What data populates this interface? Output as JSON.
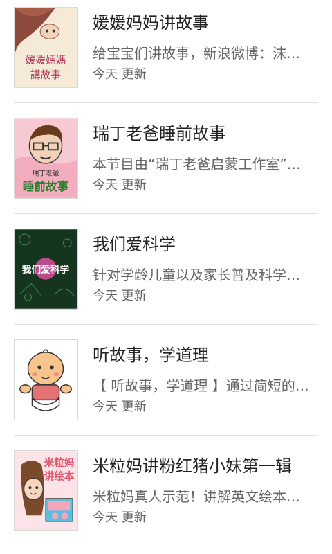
{
  "items": [
    {
      "title": "媛媛妈妈讲故事",
      "description": "给宝宝们讲故事，新浪微博：沫萌宝宝",
      "updated": "今天 更新",
      "thumb_icon": "handdrawn-girl-thumbnail",
      "thumb_text": "媛媛媽媽講故事",
      "bg": "#f5ead7"
    },
    {
      "title": "瑞丁老爸睡前故事",
      "description": "本节目由“瑞丁老爸启蒙工作室”创作",
      "updated": "今天 更新",
      "thumb_icon": "cartoon-dad-thumbnail",
      "thumb_text_1": "瑞丁老爸",
      "thumb_text_2": "睡前故事",
      "bg": "#f6c9d3"
    },
    {
      "title": "我们爱科学",
      "description": "针对学龄儿童以及家长普及科学知识",
      "updated": "今天 更新",
      "thumb_icon": "science-chalkboard-thumbnail",
      "thumb_text": "我们爱科学",
      "bg": "#15351f"
    },
    {
      "title": "听故事，学道理",
      "description": "【 听故事，学道理 】通过简短的故事",
      "updated": "今天 更新",
      "thumb_icon": "baby-cartoon-thumbnail",
      "bg": "#ffffff"
    },
    {
      "title": "米粒妈讲粉红猪小妹第一辑",
      "description": "米粒妈真人示范！讲解英文绘本《小猪佩奇》",
      "updated": "今天 更新",
      "thumb_icon": "mom-storybook-thumbnail",
      "thumb_text_1": "米粒妈",
      "thumb_text_2": "讲绘本",
      "bg": "#fbe3e8"
    }
  ]
}
